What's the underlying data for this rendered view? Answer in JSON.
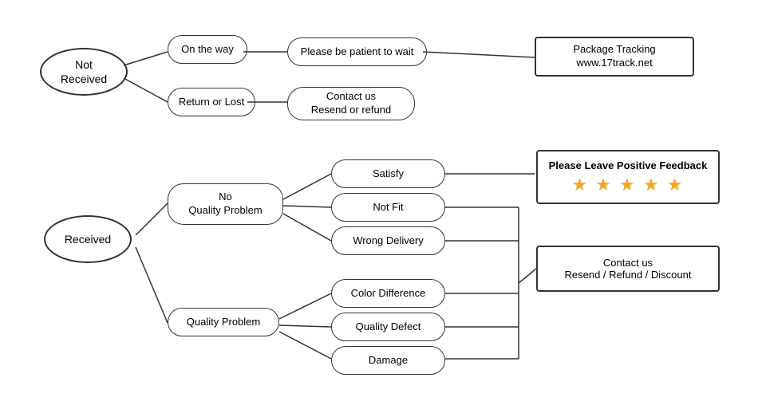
{
  "nodes": {
    "not_received": {
      "label": "Not\nReceived"
    },
    "on_the_way": {
      "label": "On the way"
    },
    "return_or_lost": {
      "label": "Return or Lost"
    },
    "please_be_patient": {
      "label": "Please be patient to wait"
    },
    "contact_resend_refund": {
      "label": "Contact us\nResend or refund"
    },
    "package_tracking": {
      "label": "Package Tracking\nwww.17track.net"
    },
    "received": {
      "label": "Received"
    },
    "no_quality_problem": {
      "label": "No\nQuality Problem"
    },
    "quality_problem": {
      "label": "Quality Problem"
    },
    "satisfy": {
      "label": "Satisfy"
    },
    "not_fit": {
      "label": "Not Fit"
    },
    "wrong_delivery": {
      "label": "Wrong Delivery"
    },
    "color_difference": {
      "label": "Color Difference"
    },
    "quality_defect": {
      "label": "Quality Defect"
    },
    "damage": {
      "label": "Damage"
    },
    "please_leave_feedback": {
      "label": "Please Leave Positive Feedback"
    },
    "stars": {
      "label": "★ ★ ★ ★ ★"
    },
    "contact_resend_refund_discount": {
      "label": "Contact us\nResend / Refund / Discount"
    }
  }
}
